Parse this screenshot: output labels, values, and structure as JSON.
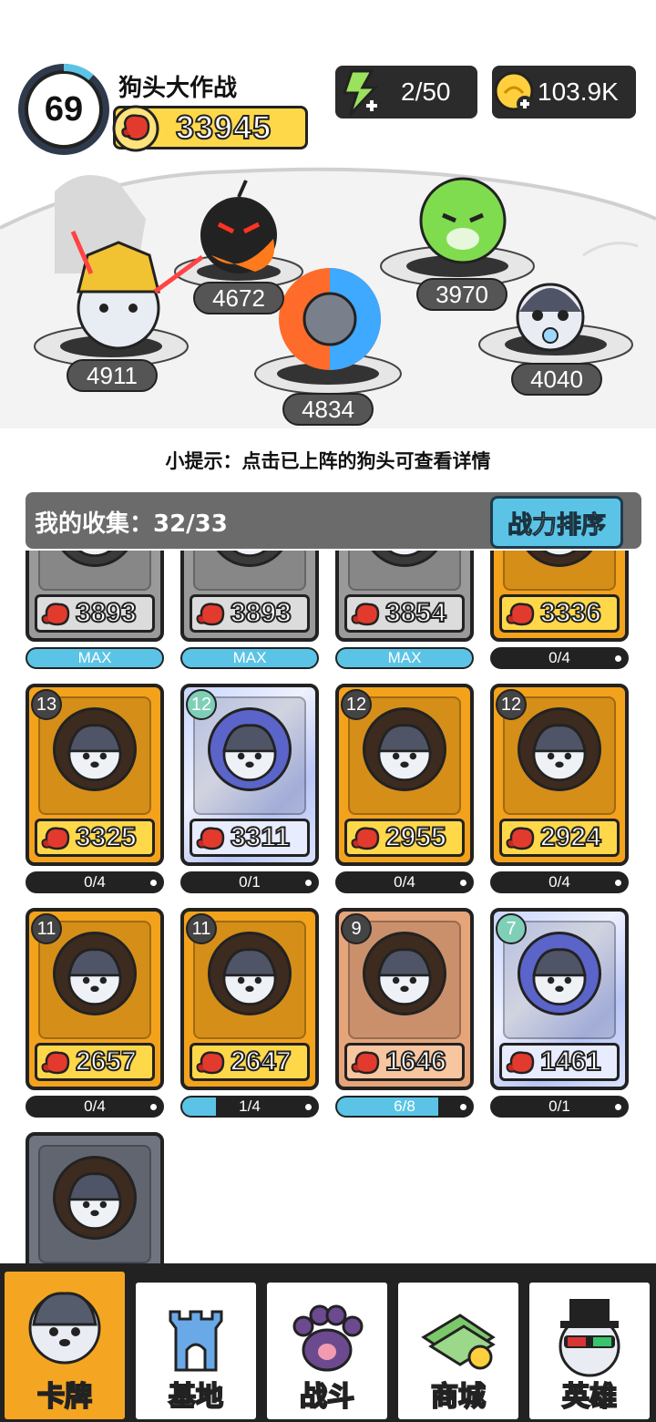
{
  "header": {
    "level": "69",
    "player_name": "狗头大作战",
    "power": "33945",
    "energy": "2/50",
    "coins": "103.9K"
  },
  "arena": {
    "lineup": [
      {
        "id": "warrior-dog",
        "power": "4911"
      },
      {
        "id": "bomb-dog",
        "power": "4672"
      },
      {
        "id": "fire-ice-dog",
        "power": "4834"
      },
      {
        "id": "cabbage-dog",
        "power": "3970"
      },
      {
        "id": "pacifier-dog",
        "power": "4040"
      }
    ],
    "hint": "小提示：点击已上阵的狗头可查看详情"
  },
  "collection": {
    "title": "我的收集：32/33",
    "sort_label": "战力排序",
    "cards": [
      {
        "rarity": "gray",
        "power": "3893",
        "level": "",
        "progress": "MAX",
        "fill": 1.0
      },
      {
        "rarity": "gray",
        "power": "3893",
        "level": "",
        "progress": "MAX",
        "fill": 1.0
      },
      {
        "rarity": "gray",
        "power": "3854",
        "level": "",
        "progress": "MAX",
        "fill": 1.0
      },
      {
        "rarity": "gold",
        "power": "3336",
        "level": "",
        "progress": "0/4",
        "fill": 0
      },
      {
        "rarity": "gold",
        "power": "3325",
        "level": "13",
        "progress": "0/4",
        "fill": 0,
        "icon": "sunglasses-dog-icon"
      },
      {
        "rarity": "holo",
        "power": "3311",
        "level": "12",
        "progress": "0/1",
        "fill": 0,
        "icon": "blurred-dog-icon"
      },
      {
        "rarity": "gold",
        "power": "2955",
        "level": "12",
        "progress": "0/4",
        "fill": 0,
        "icon": "helmet-dog-icon"
      },
      {
        "rarity": "gold",
        "power": "2924",
        "level": "12",
        "progress": "0/4",
        "fill": 0,
        "icon": "dino-hood-dog-icon"
      },
      {
        "rarity": "gold",
        "power": "2657",
        "level": "11",
        "progress": "0/4",
        "fill": 0,
        "icon": "phone-dog-icon"
      },
      {
        "rarity": "gold",
        "power": "2647",
        "level": "11",
        "progress": "1/4",
        "fill": 0.25,
        "icon": "cap-dog-icon"
      },
      {
        "rarity": "bronze",
        "power": "1646",
        "level": "9",
        "progress": "6/8",
        "fill": 0.75,
        "icon": "shiba-dog-icon"
      },
      {
        "rarity": "holo",
        "power": "1461",
        "level": "7",
        "progress": "0/1",
        "fill": 0,
        "icon": "glitch-dog-icon"
      },
      {
        "rarity": "dark",
        "power": "",
        "level": "",
        "progress": "",
        "fill": 0,
        "icon": "crown-dog-icon"
      }
    ]
  },
  "nav": [
    {
      "label": "卡牌",
      "icon": "dog-card-icon",
      "active": true
    },
    {
      "label": "基地",
      "icon": "castle-icon",
      "active": false
    },
    {
      "label": "战斗",
      "icon": "paw-icon",
      "active": false
    },
    {
      "label": "商城",
      "icon": "money-icon",
      "active": false
    },
    {
      "label": "英雄",
      "icon": "top-hat-dog-icon",
      "active": false
    }
  ],
  "colors": {
    "gold_card": "#f3a21c",
    "accent_blue": "#5bc4e6",
    "power_yellow": "#ffd84a",
    "nav_active": "#f4a622"
  }
}
